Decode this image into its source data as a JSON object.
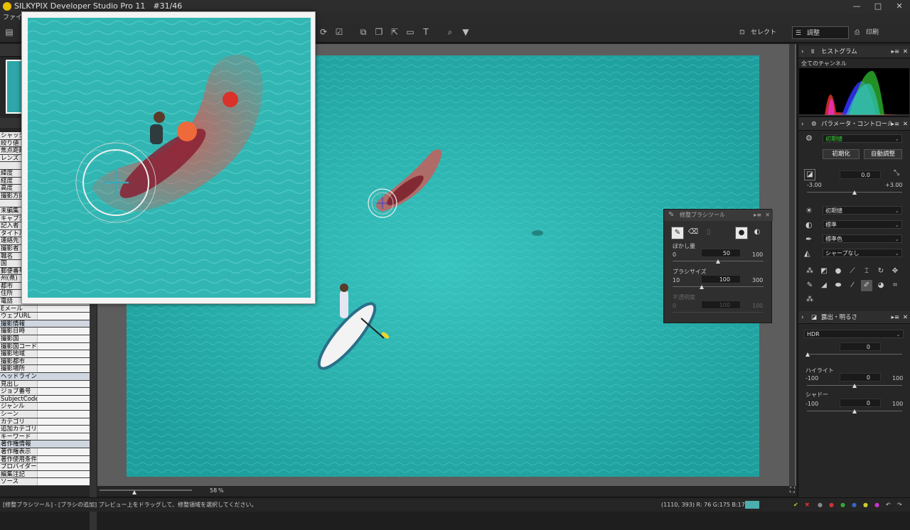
{
  "app": {
    "title": "SILKYPIX Developer Studio Pro 11　#31/46",
    "window_controls": [
      "—",
      "□",
      "✕"
    ]
  },
  "menu": {
    "items": [
      "ファイル"
    ]
  },
  "toolbar": {
    "select_label": "セレクト",
    "adjust_label": "調整",
    "print_label": "印刷"
  },
  "metadata": {
    "rows": [
      {
        "k": "シャッター",
        "v": ""
      },
      {
        "k": "絞り値",
        "v": ""
      },
      {
        "k": "焦点距離",
        "v": ""
      },
      {
        "k": "レンズ",
        "v": ""
      },
      {
        "k": "",
        "v": ""
      },
      {
        "k": "緯度",
        "v": ""
      },
      {
        "k": "経度",
        "v": ""
      },
      {
        "k": "高度",
        "v": ""
      },
      {
        "k": "撮影方向",
        "v": ""
      },
      {
        "k": "",
        "v": ""
      },
      {
        "k": "未編集",
        "v": ""
      },
      {
        "k": "キャプション",
        "v": ""
      },
      {
        "k": "記入者",
        "v": ""
      },
      {
        "k": "タイトル",
        "v": ""
      },
      {
        "k": "連絡先",
        "v": ""
      },
      {
        "k": "撮影者",
        "v": ""
      },
      {
        "k": "職名",
        "v": ""
      },
      {
        "k": "国",
        "v": ""
      },
      {
        "k": "郵便番号",
        "v": ""
      },
      {
        "k": "州(県)",
        "v": ""
      },
      {
        "k": "都市",
        "v": ""
      },
      {
        "k": "住所",
        "v": ""
      },
      {
        "k": "電話",
        "v": ""
      },
      {
        "k": "Eメール",
        "v": ""
      },
      {
        "k": "ウェブURL",
        "v": ""
      },
      {
        "k": "撮影情報",
        "v": "",
        "sec": true
      },
      {
        "k": "撮影日時",
        "v": ""
      },
      {
        "k": "撮影国",
        "v": ""
      },
      {
        "k": "撮影国コード",
        "v": ""
      },
      {
        "k": "撮影地域",
        "v": ""
      },
      {
        "k": "撮影都市",
        "v": ""
      },
      {
        "k": "撮影場所",
        "v": ""
      },
      {
        "k": "ヘッドライン",
        "v": "",
        "sec": true
      },
      {
        "k": "見出し",
        "v": ""
      },
      {
        "k": "ジョブ番号",
        "v": ""
      },
      {
        "k": "SubjectCode",
        "v": ""
      },
      {
        "k": "ジャンル",
        "v": ""
      },
      {
        "k": "シーン",
        "v": ""
      },
      {
        "k": "カテゴリ",
        "v": ""
      },
      {
        "k": "追加カテゴリ",
        "v": ""
      },
      {
        "k": "キーワード",
        "v": ""
      },
      {
        "k": "著作権情報",
        "v": "",
        "sec": true
      },
      {
        "k": "著作権表示",
        "v": ""
      },
      {
        "k": "著作使用条件",
        "v": ""
      },
      {
        "k": "プロバイダー",
        "v": ""
      },
      {
        "k": "編集注記",
        "v": ""
      },
      {
        "k": "ソース",
        "v": ""
      }
    ]
  },
  "viewer": {
    "zoom": "58",
    "zoom_unit": "%"
  },
  "statusbar": {
    "message": "[修整ブラシツール] - [ブラシの追加] プレビュー上をドラッグして、修整領域を選択してください。",
    "coords": "(1110, 393) R: 76 G:175 B:174",
    "swatch_color": "#4cafae"
  },
  "histogram": {
    "title": "ヒストグラム",
    "channel": "全てのチャンネル"
  },
  "params": {
    "title": "パラメータ・コントロール",
    "preset": "初期値",
    "reset_label": "初期化",
    "auto_label": "自動調整",
    "exposure_value": "0.0",
    "exposure_min": "-3.00",
    "exposure_max": "+3.00",
    "wb": "初期値",
    "tone": "標準",
    "color": "標準色",
    "sharp": "シャープなし"
  },
  "exposure": {
    "title": "露出・明るさ",
    "hdr_label": "HDR",
    "hdr_value": "0",
    "highlight_label": "ハイライト",
    "highlight_value": "0",
    "highlight_min": "-100",
    "highlight_max": "100",
    "shadow_label": "シャドー",
    "shadow_value": "0",
    "shadow_min": "-100",
    "shadow_max": "100"
  },
  "brush": {
    "title": "修整ブラシツール",
    "blur_label": "ぼかし量",
    "blur_min": "0",
    "blur_value": "50",
    "blur_max": "100",
    "size_label": "ブラシサイズ",
    "size_min": "10",
    "size_value": "100",
    "size_max": "300",
    "opacity_label": "不透明度",
    "opacity_min": "0",
    "opacity_value": "100",
    "opacity_max": "100"
  }
}
